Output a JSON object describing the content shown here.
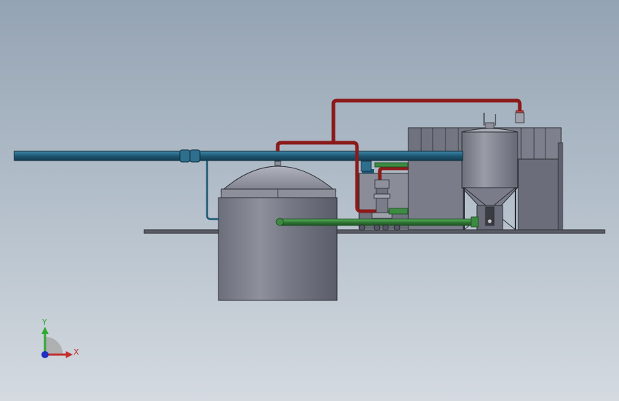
{
  "view": {
    "type": "cad-3d-assembly-front-view",
    "background_colors": [
      "#94a3b3",
      "#d4dae0"
    ]
  },
  "colors": {
    "blue_pipe": "#1e5874",
    "blue_pipe_highlight": "#3d87a8",
    "red_pipe": "#8b1a1a",
    "red_pipe_highlight": "#c24040",
    "green_pipe": "#2f7a35",
    "green_pipe_highlight": "#5fb061",
    "tank_steel": "#7c7f8c",
    "tank_steel_light": "#9fa2ad",
    "tank_steel_dark": "#575a66",
    "skid_base": "#5b5d66",
    "outline": "#2b2d33"
  },
  "triad": {
    "y_label": "Y",
    "x_label": "X",
    "y_color": "#2faa2f",
    "x_color": "#c22f2f",
    "z_color": "#1f2fbf"
  }
}
